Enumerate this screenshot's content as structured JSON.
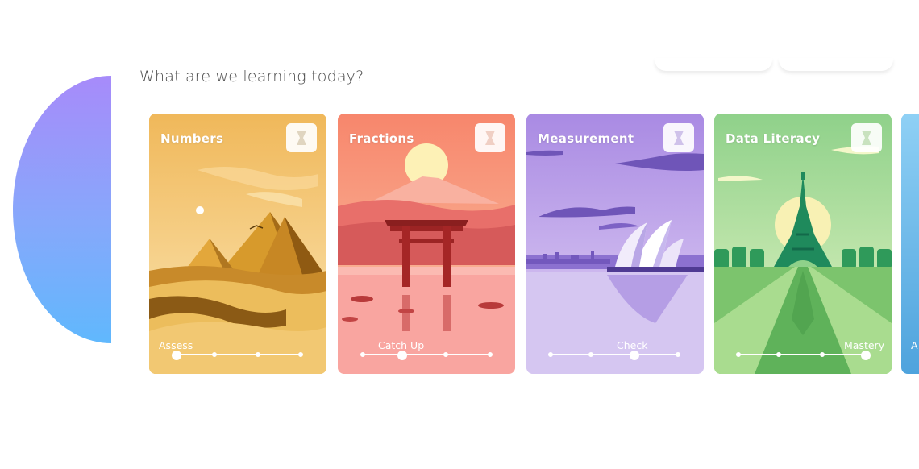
{
  "heading": "What are we learning today?",
  "cards": [
    {
      "title": "Numbers",
      "level_label": "Assess",
      "level_index": 1,
      "theme": "#f2b24c"
    },
    {
      "title": "Fractions",
      "level_label": "Catch Up",
      "level_index": 2,
      "theme": "#f7957e"
    },
    {
      "title": "Measurement",
      "level_label": "Check",
      "level_index": 3,
      "theme": "#b79ae6"
    },
    {
      "title": "Data Literacy",
      "level_label": "Mastery",
      "level_index": 4,
      "theme": "#8fd18a"
    }
  ],
  "next_card_partial_label": "A",
  "icons": {
    "badge": "hourglass-icon"
  },
  "colors": {
    "accent_gradient_start": "#a78bfa",
    "accent_gradient_end": "#60b8fd"
  }
}
